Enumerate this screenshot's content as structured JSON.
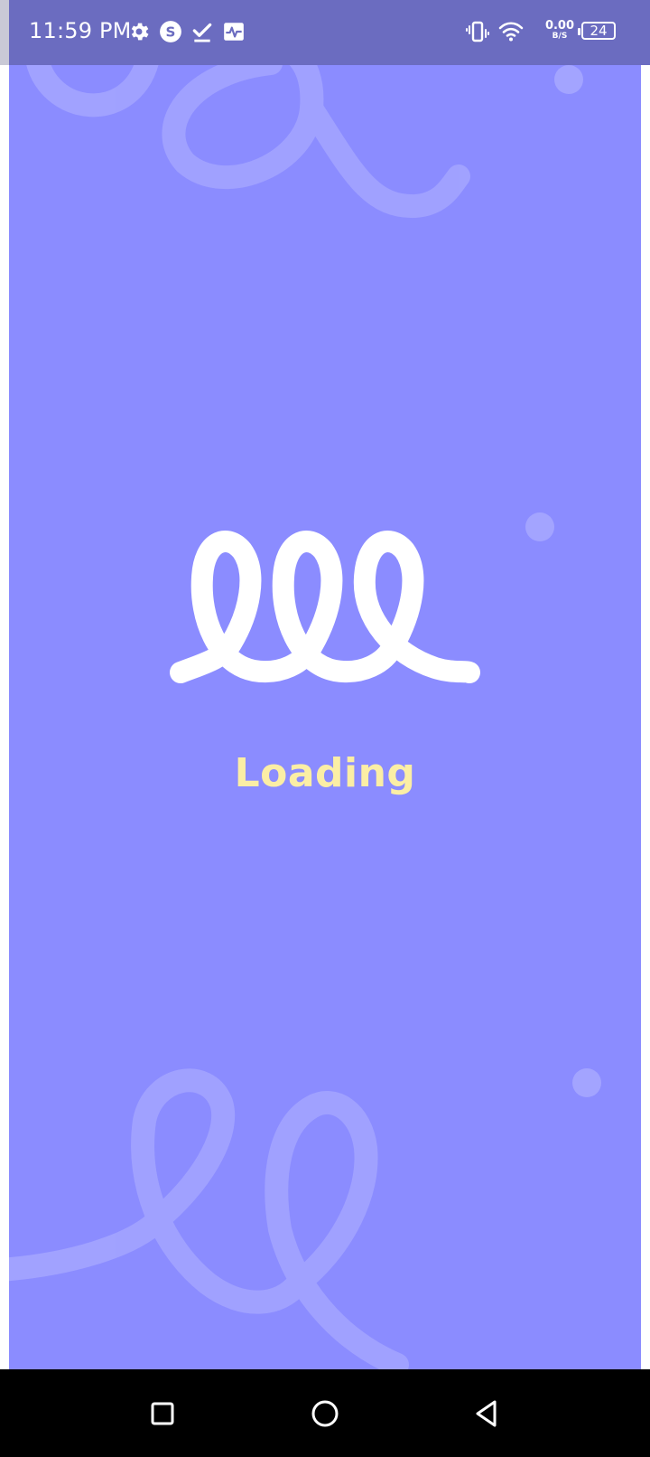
{
  "status_bar": {
    "time": "11:59 PM",
    "icons": [
      "gear-icon",
      "skype-icon",
      "checkmark-icon",
      "activity-monitor-icon",
      "vibrate-icon",
      "wifi-icon",
      "battery-icon"
    ],
    "net_speed_value": "0.00",
    "net_speed_unit": "B/S",
    "battery_level": "24"
  },
  "main": {
    "logo": "spiral-loops-logo",
    "loading_label": "Loading"
  },
  "nav_bar": {
    "buttons": [
      "recent-apps-button",
      "home-button",
      "back-button"
    ]
  },
  "colors": {
    "background": "#8b8cff",
    "status_bar": "#6b6cc0",
    "loading_text": "#fbeea5",
    "logo": "#ffffff",
    "nav_bar": "#000000"
  }
}
